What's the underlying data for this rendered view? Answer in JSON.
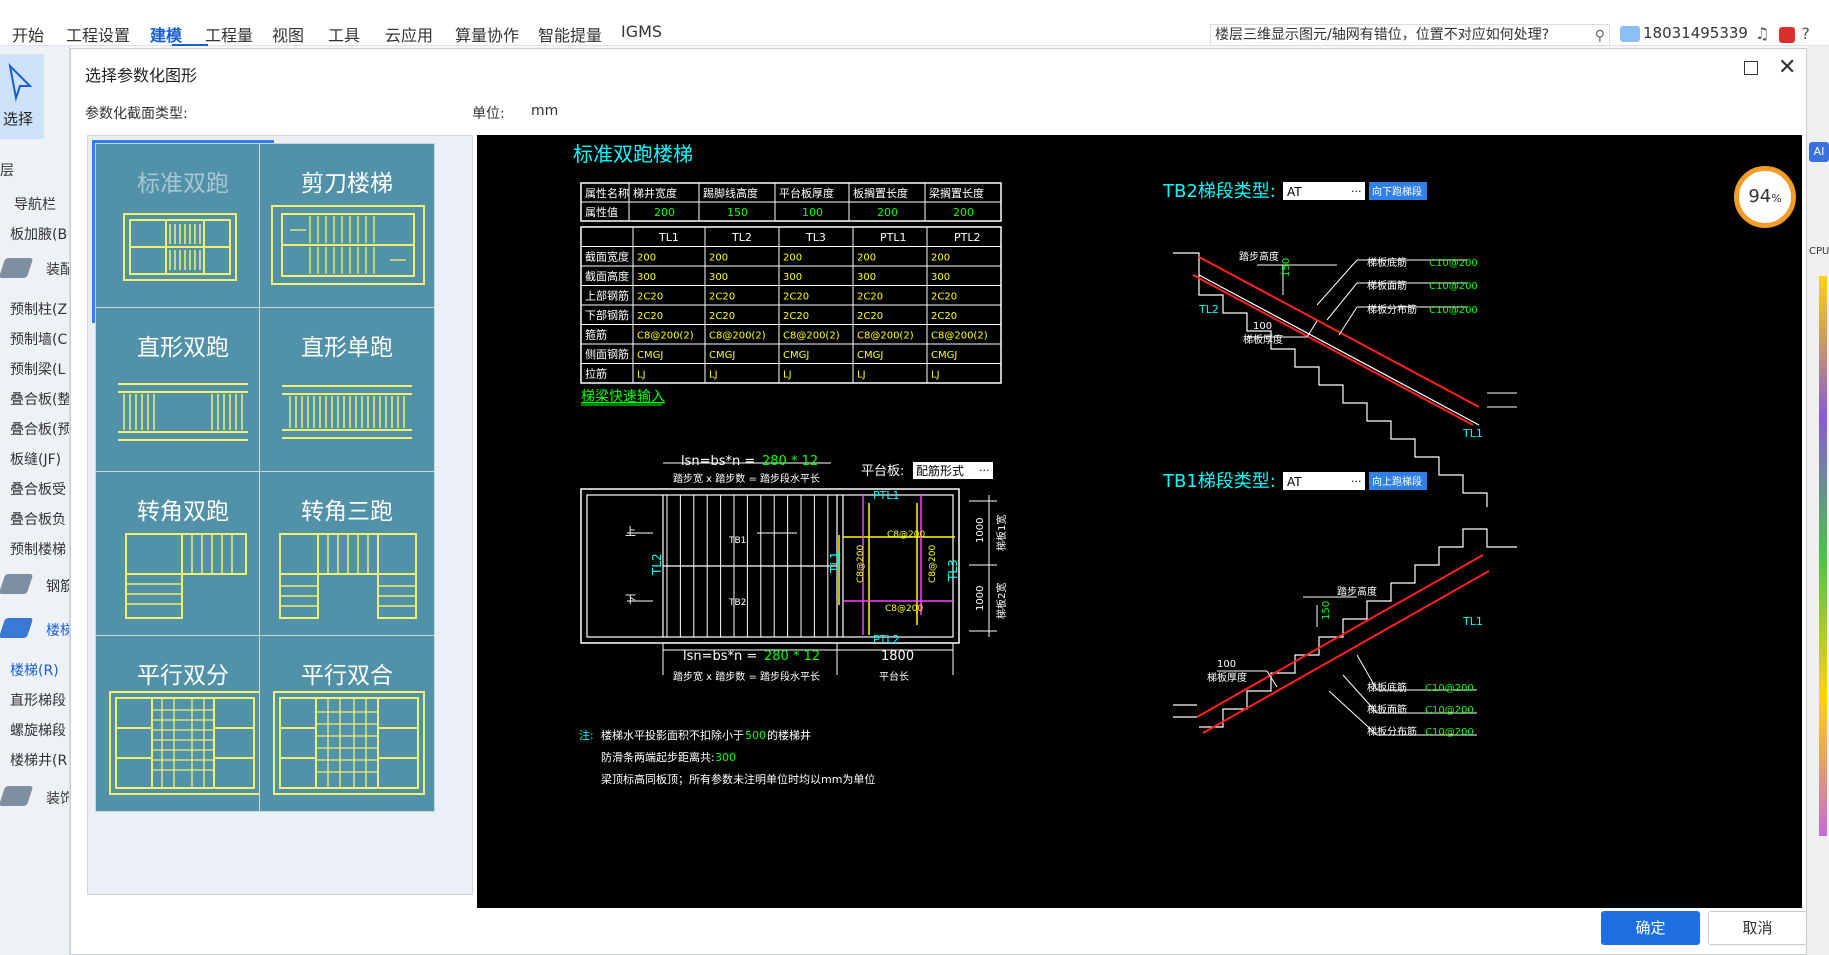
{
  "menubar": {
    "items": [
      "开始",
      "工程设置",
      "建模",
      "工程量",
      "视图",
      "工具",
      "云应用",
      "算量协作",
      "智能提量",
      "IGMS"
    ],
    "active_index": 2,
    "help_text": "楼层三维显示图元/轴网有错位，位置不对应如何处理?",
    "phone": "18031495339"
  },
  "left_panel": {
    "select_label": "选择",
    "items": [
      "层",
      "导航栏",
      "板加腋(B",
      "装配",
      "预制柱(Z",
      "预制墙(C",
      "预制梁(L",
      "叠合板(整",
      "叠合板(预",
      "板缝(JF)",
      "叠合板受",
      "叠合板负",
      "预制楼梯",
      "钢筋",
      "楼梯",
      "楼梯(R)",
      "直形梯段",
      "螺旋梯段",
      "楼梯井(R",
      "装饰"
    ]
  },
  "dialog": {
    "title": "选择参数化图形",
    "section_label": "参数化截面类型:",
    "unit_label": "单位:",
    "unit_value": "mm",
    "ok_label": "确定",
    "cancel_label": "取消"
  },
  "shapes": [
    {
      "name": "标准双跑",
      "selected": true
    },
    {
      "name": "剪刀楼梯",
      "selected": false
    },
    {
      "name": "直形双跑",
      "selected": false
    },
    {
      "name": "直形单跑",
      "selected": false
    },
    {
      "name": "转角双跑",
      "selected": false
    },
    {
      "name": "转角三跑",
      "selected": false
    },
    {
      "name": "平行双分",
      "selected": false
    },
    {
      "name": "平行双合",
      "selected": false
    }
  ],
  "cad": {
    "title": "标准双跑楼梯",
    "table1": {
      "headers": [
        "属性名称",
        "梯井宽度",
        "踢脚线高度",
        "平台板厚度",
        "板搁置长度",
        "梁搁置长度"
      ],
      "row": [
        "属性值",
        "200",
        "150",
        "100",
        "200",
        "200"
      ]
    },
    "table2": {
      "headers": [
        "",
        "TL1",
        "TL2",
        "TL3",
        "PTL1",
        "PTL2"
      ],
      "rows": [
        [
          "截面宽度",
          "200",
          "200",
          "200",
          "200",
          "200"
        ],
        [
          "截面高度",
          "300",
          "300",
          "300",
          "300",
          "300"
        ],
        [
          "上部钢筋",
          "2C20",
          "2C20",
          "2C20",
          "2C20",
          "2C20"
        ],
        [
          "下部钢筋",
          "2C20",
          "2C20",
          "2C20",
          "2C20",
          "2C20"
        ],
        [
          "箍筋",
          "C8@200(2)",
          "C8@200(2)",
          "C8@200(2)",
          "C8@200(2)",
          "C8@200(2)"
        ],
        [
          "侧面钢筋",
          "CMGJ",
          "CMGJ",
          "CMGJ",
          "CMGJ",
          "CMGJ"
        ],
        [
          "拉筋",
          "LJ",
          "LJ",
          "LJ",
          "LJ",
          "LJ"
        ]
      ]
    },
    "quick_input": "梯梁快速输入",
    "tb2_label": "TB2梯段类型:",
    "tb2_value": "AT",
    "tb2_button": "向下跑梯段",
    "tb1_label": "TB1梯段类型:",
    "tb1_value": "AT",
    "tb1_button": "向上跑梯段",
    "platform_label": "平台板:",
    "platform_value": "配筋形式",
    "formula_top": "lsn=bs*n = ",
    "formula_value": "280 * 12",
    "formula_sub": "踏步宽 x 踏步数 = 踏步段水平长",
    "platform_len": "1800",
    "platform_len_label": "平台长",
    "step_height": "踏步高度",
    "plate_thick": "梯板厚度",
    "thick_value": "100",
    "height_value": "150",
    "rebar_bottom": "梯板底筋",
    "rebar_top": "梯板面筋",
    "rebar_dist": "梯板分布筋",
    "rebar_value": "C10@200",
    "plan_labels": {
      "tl1": "TL1",
      "tl2": "TL2",
      "tl3": "TL3",
      "ptl1": "PTL1",
      "ptl2": "PTL2",
      "tb1": "TB1",
      "tb2": "TB2",
      "up": "上",
      "down": "下",
      "c8": "C8@200",
      "dim1000": "1000",
      "width1": "梯板1宽",
      "width2": "梯板2宽"
    },
    "notes": {
      "prefix": "注:",
      "line1_a": "楼梯水平投影面积不扣除小于",
      "line1_value": "500",
      "line1_b": "的楼梯井",
      "line2_a": "防滑条两端起步距离共:",
      "line2_value": "300",
      "line3": "梁顶标高同板顶；所有参数未注明单位时均以mm为单位"
    }
  },
  "gauge": {
    "value": "94",
    "unit": "%",
    "label": "CPU"
  },
  "badge": {
    "ai": "AI"
  },
  "colors": {
    "accent": "#1c6fe0",
    "shape_bg": "#5292a9",
    "cad_cyan": "#00ffff",
    "cad_green": "#00ff00",
    "cad_yellow": "#ffff00"
  }
}
